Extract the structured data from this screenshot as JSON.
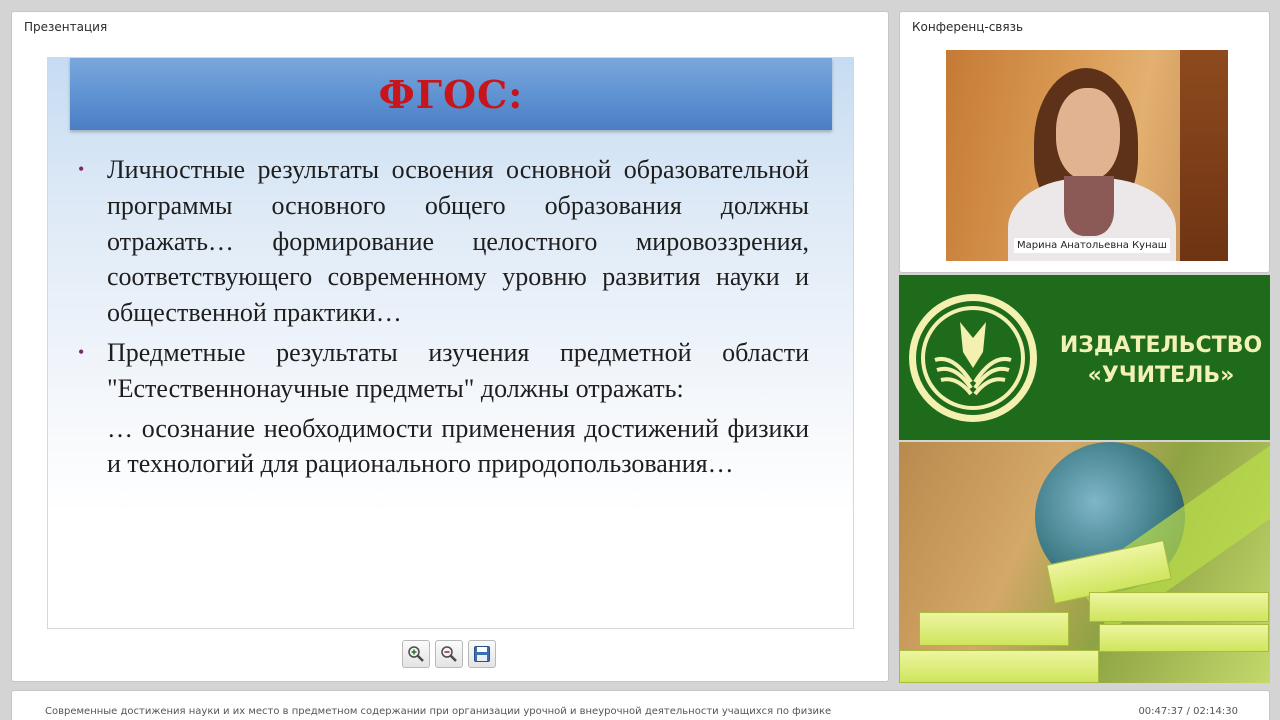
{
  "presentation": {
    "panel_title": "Презентация",
    "slide": {
      "title": "ФГОС:",
      "bullets": [
        "Личностные результаты освоения основной образовательной программы основного общего образования должны отражать… формирование целостного мировоззрения, соответствующего современному уровню развития науки и общественной практики…",
        "Предметные результаты изучения предметной области \"Естественнонаучные предметы\" должны отражать:"
      ],
      "sub_paragraph": "… осознание необходимости применения достижений физики и технологий для рационального природопользования…"
    },
    "toolbar": {
      "zoom_in_icon": "zoom-in-icon",
      "zoom_out_icon": "zoom-out-icon",
      "save_icon": "floppy-disk-icon"
    }
  },
  "conference": {
    "panel_title": "Конференц-связь",
    "speaker_name": "Марина Анатольевна Кунаш"
  },
  "publisher": {
    "line1": "ИЗДАТЕЛЬСТВО",
    "line2": "«УЧИТЕЛЬ»",
    "colors": {
      "green": "#1f6b1c",
      "text": "#f4f1b6"
    }
  },
  "footer": {
    "title": "Современные достижения науки и их место в предметном содержании при организации урочной и внеурочной деятельности учащихся по физике",
    "time": "00:47:37 / 02:14:30"
  }
}
